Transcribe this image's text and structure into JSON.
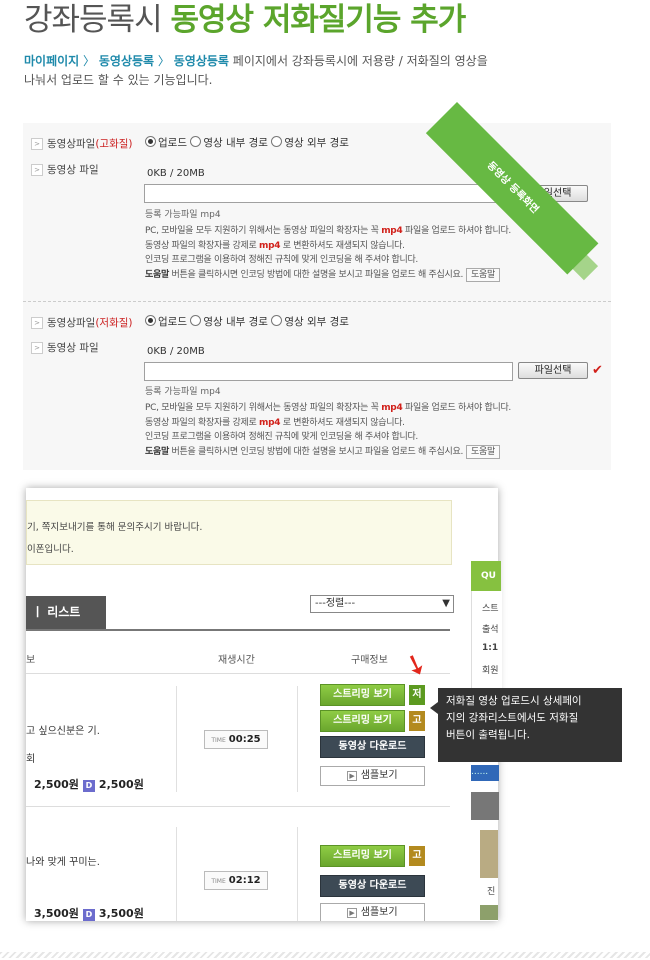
{
  "header": {
    "title_prefix": "강좌등록시",
    "title_highlight": "동영상 저화질기능 추가",
    "desc_path": [
      "마이페이지",
      "동영상등록",
      "동영상등록"
    ],
    "desc_sep": "〉",
    "desc_text_1": "페이지에서 강좌등록시에 저용량 / 저화질의 영상을",
    "desc_text_2": "나눠서 업로드 할 수 있는 기능입니다."
  },
  "ribbon": {
    "label": "동영상 등록화면"
  },
  "form": {
    "blocks": [
      {
        "type_label": "동영상파일",
        "type_quality": "(고화질)",
        "file_label": "동영상 파일",
        "radios": [
          "업로드",
          "영상 내부 경로",
          "영상 외부 경로"
        ],
        "selected": 0,
        "size": "0KB / 20MB",
        "file_value": "",
        "file_button": "파일선택",
        "allowed": "등록 가능파일 mp4",
        "note1_a": "PC, 모바일을 모두 지원하기 위해서는 동영상 파일의 확장자는 꼭",
        "note1_mp4": "mp4",
        "note1_b": "파일을 업로드 하셔야 합니다.",
        "note2_a": "동영상 파일의 확장자를 강제로",
        "note2_mp4": "mp4",
        "note2_b": "로 변환하셔도 재생되지 않습니다.",
        "note3": "인코딩 프로그램을 이용하여 정해진 규칙에 맞게 인코딩을 해 주셔야 합니다.",
        "note4_bold": "도움말",
        "note4_text": "버튼을 클릭하시면 인코딩 방법에 대한 설명을 보시고 파일을 업로드 해 주십시요.",
        "help_button": "도움말"
      },
      {
        "type_label": "동영상파일",
        "type_quality": "(저화질)",
        "file_label": "동영상 파일",
        "radios": [
          "업로드",
          "영상 내부 경로",
          "영상 외부 경로"
        ],
        "selected": 0,
        "size": "0KB / 20MB",
        "file_value": "",
        "file_button": "파일선택",
        "allowed": "등록 가능파일 mp4",
        "note1_a": "PC, 모바일을 모두 지원하기 위해서는 동영상 파일의 확장자는 꼭",
        "note1_mp4": "mp4",
        "note1_b": "파일을 업로드 하셔야 합니다.",
        "note2_a": "동영상 파일의 확장자를 강제로",
        "note2_mp4": "mp4",
        "note2_b": "로 변환하셔도 재생되지 않습니다.",
        "note3": "인코딩 프로그램을 이용하여 정해진 규칙에 맞게 인코딩을 해 주셔야 합니다.",
        "note4_bold": "도움말",
        "note4_text": "버튼을 클릭하시면 인코딩 방법에 대한 설명을 보시고 파일을 업로드 해 주십시요.",
        "help_button": "도움말"
      }
    ]
  },
  "screen": {
    "info_line1": "기, 쪽지보내기를 통해 문의주시기 바랍니다.",
    "info_line2": "이폰입니다.",
    "list_tab": "ㅣ 리스트",
    "sort_value": "---정렬---",
    "headers": [
      "보",
      "재생시간",
      "구매정보"
    ],
    "rows": [
      {
        "desc1": "고 싶으신분은 기.",
        "desc2": "회",
        "price1": "2,500원",
        "badge": "D",
        "price2": "2,500원",
        "time_label": "TIME",
        "time": "00:25",
        "btn_stream_low": "스트리밍 보기",
        "tag_low": "저",
        "btn_stream_high": "스트리밍 보기",
        "tag_high": "고",
        "btn_download": "동영상 다운로드",
        "btn_sample": "샘플보기"
      },
      {
        "desc1": "나와 맞게 꾸미는.",
        "desc2": "",
        "price1": "3,500원",
        "badge": "D",
        "price2": "3,500원",
        "time_label": "TIME",
        "time": "02:12",
        "btn_stream_high": "스트리밍 보기",
        "tag_high": "고",
        "btn_download": "동영상 다운로드",
        "btn_sample": "샘플보기"
      }
    ],
    "side": {
      "qu": "QU",
      "s1": "스트",
      "s2": "출석",
      "s3": "1:1",
      "s4": "회원",
      "dots": "......",
      "s5": "진"
    }
  },
  "tooltip": {
    "line1": "저화질 영상 업로드시 상세페이",
    "line2": "지의 강좌리스트에서도 저화질",
    "line3": "버튼이 출력됩니다."
  },
  "colors": {
    "accent_green": "#5ba52c",
    "path_blue": "#1f8aab",
    "red": "#d1201a"
  }
}
